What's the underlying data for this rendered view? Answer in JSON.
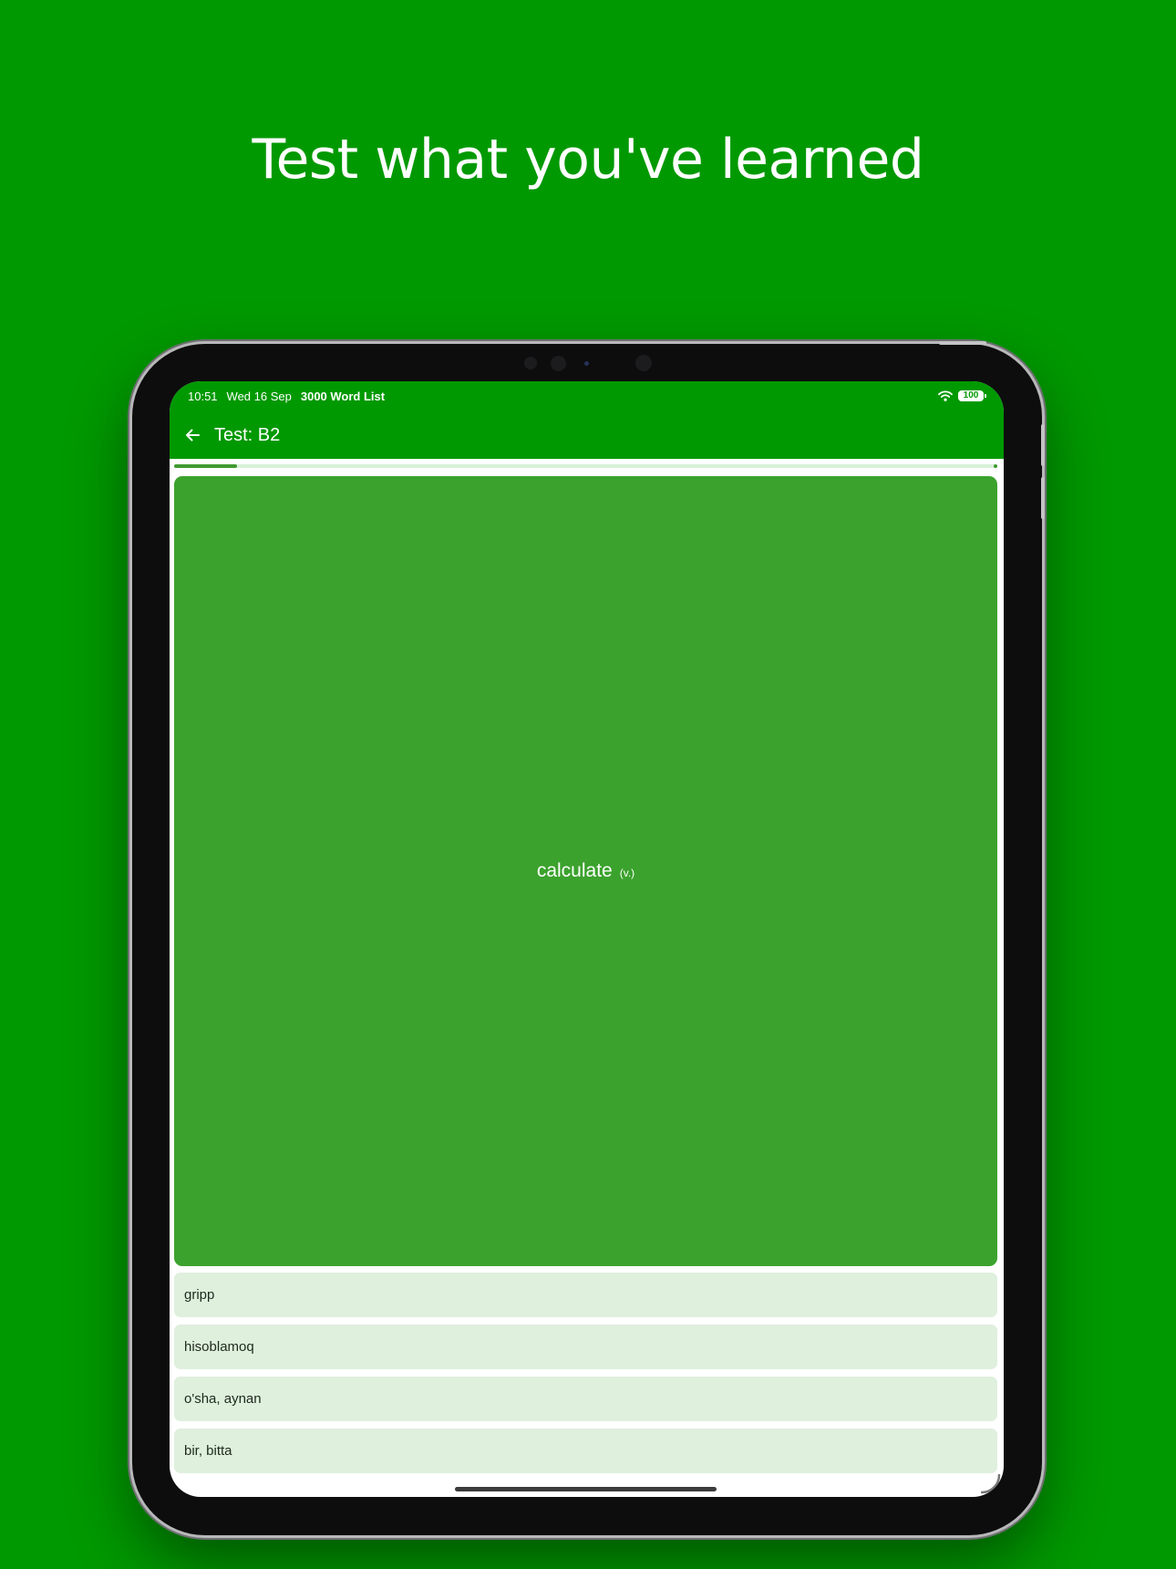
{
  "headline": "Test what you've learned",
  "status_bar": {
    "time": "10:51",
    "date": "Wed 16 Sep",
    "app_name": "3000 Word List",
    "battery": "100",
    "wifi_icon": "wifi-icon"
  },
  "toolbar": {
    "back_icon": "arrow-left-icon",
    "title": "Test: B2"
  },
  "progress": {
    "fraction": 0.077
  },
  "question": {
    "word": "calculate",
    "part_of_speech": "(v.)"
  },
  "options": [
    {
      "label": "gripp"
    },
    {
      "label": "hisoblamoq"
    },
    {
      "label": "o'sha, aynan"
    },
    {
      "label": "bir, bitta"
    }
  ],
  "colors": {
    "background": "#019901",
    "card": "#3ba22d",
    "option": "#dff0dd",
    "progress": "#3f9a30"
  }
}
